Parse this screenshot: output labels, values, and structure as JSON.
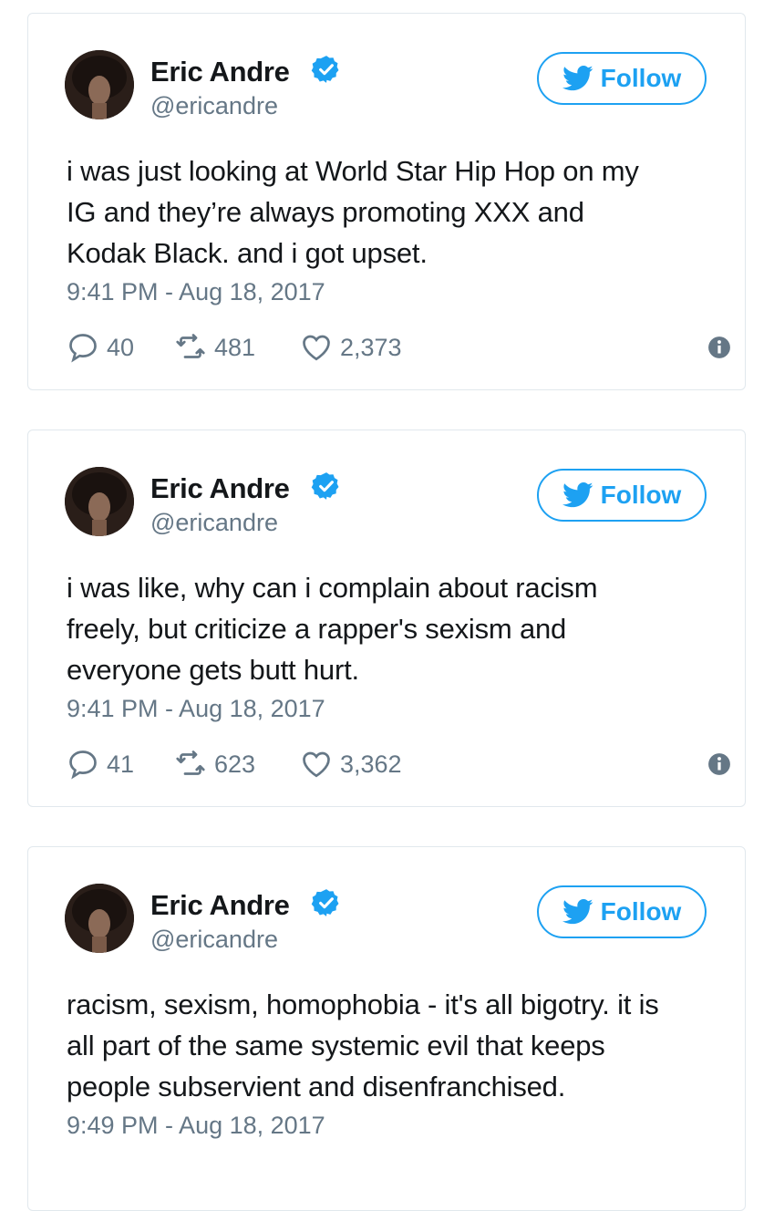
{
  "colors": {
    "accent": "#1da1f2",
    "secondary_text": "#657786",
    "border": "#e1e8ed"
  },
  "icons": {
    "verified": "verified-badge-icon",
    "follow": "twitter-bird-icon",
    "reply": "reply-bubble-icon",
    "retweet": "retweet-icon",
    "like": "heart-icon",
    "info": "info-icon"
  },
  "tweets": [
    {
      "name": "Eric Andre",
      "handle": "@ericandre",
      "follow_label": "Follow",
      "text": "i was just looking at World Star Hip Hop on my\nIG and they’re always promoting XXX and\nKodak Black. and i got upset.",
      "timestamp": "9:41 PM - Aug 18, 2017",
      "replies": "40",
      "retweets": "481",
      "likes": "2,373"
    },
    {
      "name": "Eric Andre",
      "handle": "@ericandre",
      "follow_label": "Follow",
      "text": "i was like, why can i complain about racism\nfreely, but criticize a rapper's sexism and\neveryone gets butt hurt.",
      "timestamp": "9:41 PM - Aug 18, 2017",
      "replies": "41",
      "retweets": "623",
      "likes": "3,362"
    },
    {
      "name": "Eric Andre",
      "handle": "@ericandre",
      "follow_label": "Follow",
      "text": "racism, sexism, homophobia - it's all bigotry. it is\nall part of the same systemic evil that keeps\npeople subservient and disenfranchised.",
      "timestamp": "9:49 PM - Aug 18, 2017"
    }
  ]
}
